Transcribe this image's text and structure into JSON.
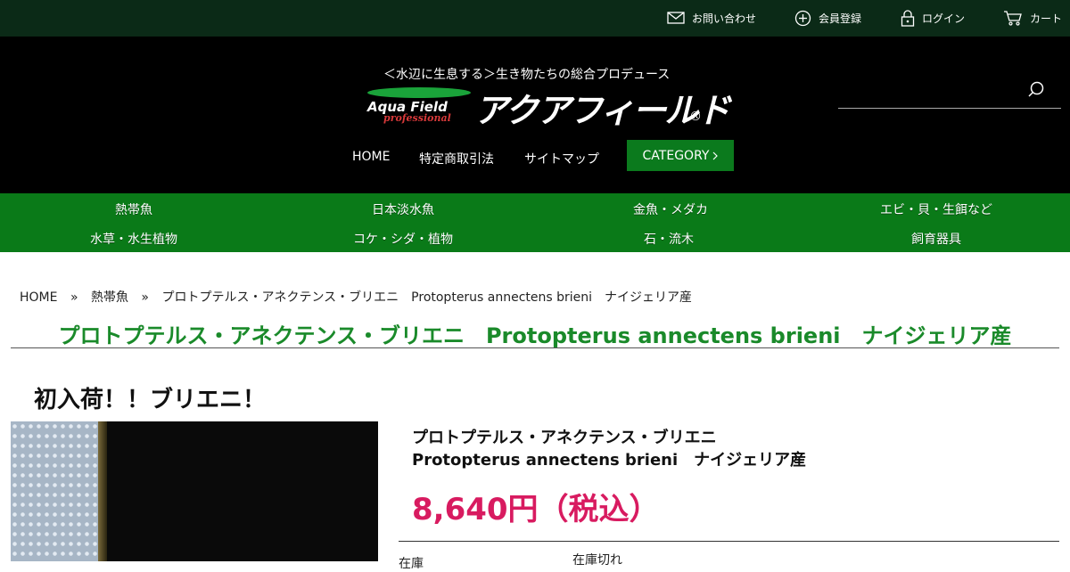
{
  "topbar": {
    "contact": "お問い合わせ",
    "register": "会員登録",
    "login": "ログイン",
    "cart": "カート"
  },
  "header": {
    "tagline": "＜水辺に生息する＞生き物たちの総合プロデュース",
    "logo_en": "Aqua Field",
    "logo_sub": "professional",
    "logo_jp": "アクアフィールド",
    "logo_reg": "®",
    "nav": [
      "HOME",
      "特定商取引法",
      "サイトマップ"
    ],
    "category_button": "CATEGORY",
    "search_placeholder": ""
  },
  "categories": [
    "熱帯魚",
    "日本淡水魚",
    "金魚・メダカ",
    "エビ・貝・生餌など",
    "水草・水生植物",
    "コケ・シダ・植物",
    "石・流木",
    "飼育器具"
  ],
  "breadcrumb": [
    "HOME",
    "熱帯魚",
    "プロトプテルス・アネクテンス・ブリエニ　Protopterus annectens brieni　ナイジェリア産"
  ],
  "breadcrumb_sep": "»",
  "product": {
    "title": "プロトプテルス・アネクテンス・ブリエニ　Protopterus annectens brieni　ナイジェリア産",
    "headline": "初入荷！！ブリエニ！",
    "name_line1": "プロトプテルス・アネクテンス・ブリエニ",
    "name_line2": "Protopterus annectens brieni　ナイジェリア産",
    "price": "8,640円（税込）",
    "stock_label": "在庫",
    "stock_value": "在庫切れ"
  },
  "colors": {
    "topbar_bg": "#0b2a17",
    "header_bg": "#000000",
    "category_bar": "#0a7a18",
    "title_green": "#1a8a2a",
    "price_pink": "#d81b60"
  }
}
